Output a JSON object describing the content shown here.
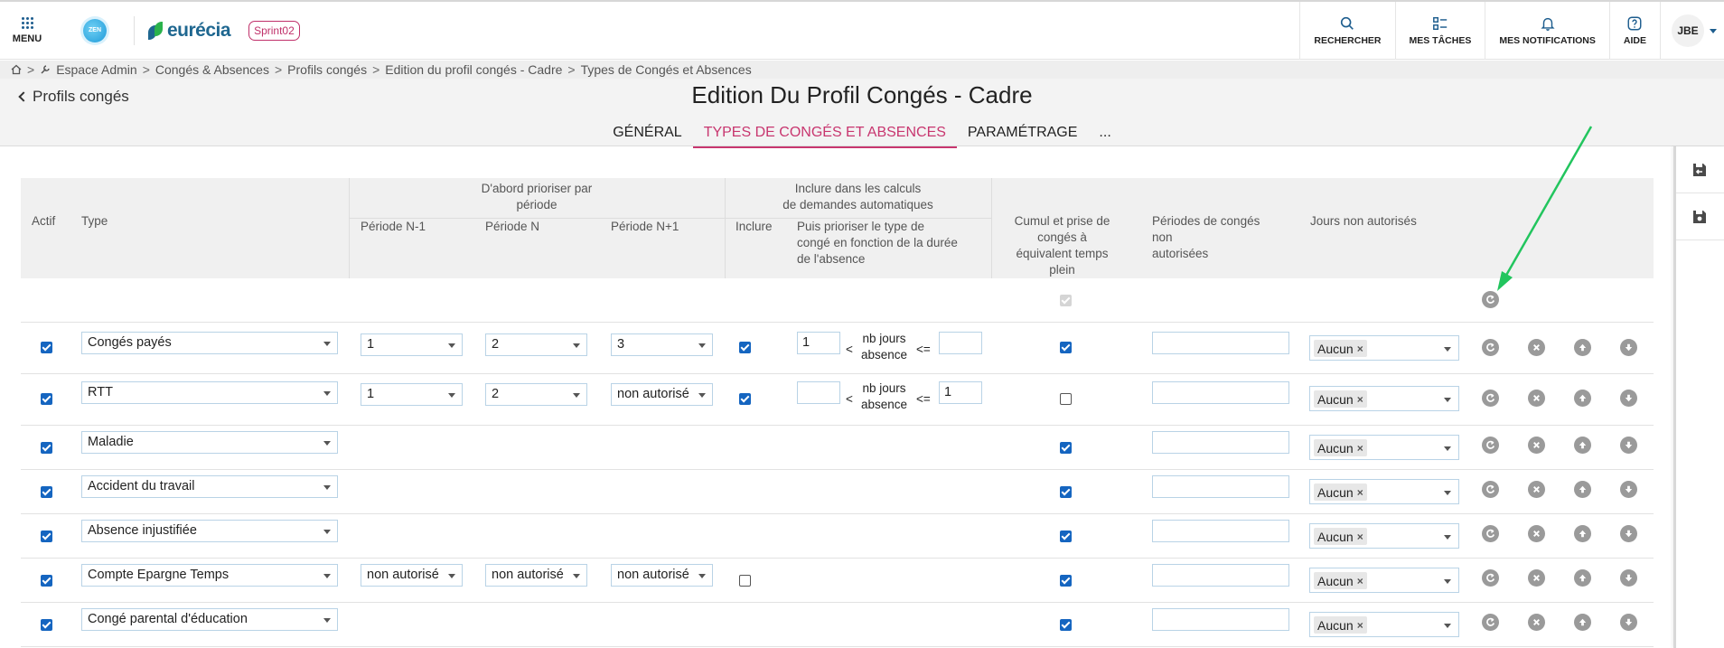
{
  "header": {
    "menu_label": "MENU",
    "zen_label": "ZEN",
    "brand_name": "eurécia",
    "sprint_badge": "Sprint02",
    "nav": [
      {
        "label": "RECHERCHER",
        "icon": "search-icon"
      },
      {
        "label": "MES TÂCHES",
        "icon": "tasks-icon"
      },
      {
        "label": "MES NOTIFICATIONS",
        "icon": "bell-icon"
      },
      {
        "label": "AIDE",
        "icon": "help-icon"
      }
    ],
    "user_initials": "JBE"
  },
  "breadcrumb": {
    "items": [
      "Espace Admin",
      "Congés & Absences",
      "Profils congés",
      "Edition du profil congés - Cadre",
      "Types de Congés et Absences"
    ]
  },
  "page": {
    "back_label": "Profils congés",
    "title": "Edition Du Profil Congés - Cadre",
    "tabs": [
      {
        "label": "GÉNÉRAL",
        "active": false
      },
      {
        "label": "TYPES DE CONGÉS ET ABSENCES",
        "active": true
      },
      {
        "label": "PARAMÉTRAGE",
        "active": false
      },
      {
        "label": "...",
        "active": false
      }
    ]
  },
  "table": {
    "headers": {
      "actif": "Actif",
      "type": "Type",
      "prioritize_group": [
        "D'abord prioriser par",
        "période"
      ],
      "period_n1": "Période N-1",
      "period_n": "Période N",
      "period_np1": "Période N+1",
      "include_group": [
        "Inclure dans les calculs",
        "de demandes automatiques"
      ],
      "inclure": "Inclure",
      "puis_prioriser": [
        "Puis prioriser le type de",
        "congé en fonction de la durée",
        "de l'absence"
      ],
      "cumul": [
        "Cumul et prise de",
        "congés à",
        "équivalent temps",
        "plein"
      ],
      "periodes_non_autorisees": [
        "Périodes de congés",
        "non",
        "autorisées"
      ],
      "jours_non_autorises": "Jours non autorisés"
    },
    "range_text": {
      "lt": "<",
      "nb_jours": "nb jours",
      "absence": "absence",
      "le": "<="
    },
    "rows": [
      {
        "actif": true,
        "type": "Congés payés",
        "n1": "1",
        "n": "2",
        "np1": "3",
        "inclure": true,
        "min": "1",
        "max": "",
        "cumul": true,
        "periods": "",
        "days_tag": "Aucun"
      },
      {
        "actif": true,
        "type": "RTT",
        "n1": "1",
        "n": "2",
        "np1": "non autorisé",
        "inclure": true,
        "min": "",
        "max": "1",
        "cumul": false,
        "periods": "",
        "days_tag": "Aucun"
      },
      {
        "actif": true,
        "type": "Maladie",
        "cumul": true,
        "periods": "",
        "days_tag": "Aucun"
      },
      {
        "actif": true,
        "type": "Accident du travail",
        "cumul": true,
        "periods": "",
        "days_tag": "Aucun"
      },
      {
        "actif": true,
        "type": "Absence injustifiée",
        "cumul": true,
        "periods": "",
        "days_tag": "Aucun"
      },
      {
        "actif": true,
        "type": "Compte Epargne Temps",
        "n1": "non autorisé",
        "n": "non autorisé",
        "np1": "non autorisé",
        "inclure": false,
        "cumul": true,
        "periods": "",
        "days_tag": "Aucun"
      },
      {
        "actif": true,
        "type": "Congé parental d'éducation",
        "cumul": true,
        "periods": "",
        "days_tag": "Aucun"
      }
    ],
    "row_actions": [
      "reset-icon",
      "delete-icon",
      "move-up-icon",
      "move-down-icon"
    ]
  },
  "side_toolbar": {
    "icons": [
      "save-and-return-icon",
      "save-icon"
    ]
  },
  "colors": {
    "accent_pink": "#c8366f",
    "brand_blue": "#1f6790",
    "checkbox_blue": "#1565c0",
    "annotation_arrow": "#22c55e"
  }
}
